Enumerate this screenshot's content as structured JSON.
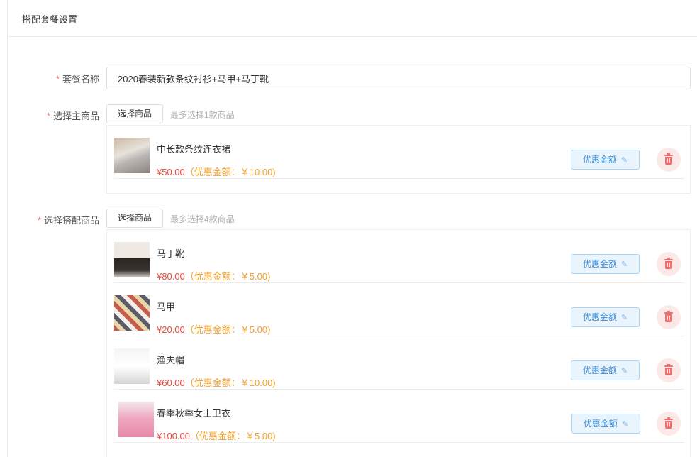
{
  "header": {
    "title": "搭配套餐设置"
  },
  "form": {
    "required_mark": "*",
    "name_label": "套餐名称",
    "name_value": "2020春装新款条纹衬衫+马甲+马丁靴",
    "main_label": "选择主商品",
    "main_select_button": "选择商品",
    "main_hint": "最多选择1款商品",
    "combo_label": "选择搭配商品",
    "combo_select_button": "选择商品",
    "combo_hint": "最多选择4款商品"
  },
  "discount_button_label": "优惠金额",
  "main_products": [
    {
      "name": "中长款条纹连衣裙",
      "price": "¥50.00",
      "discount": "（优惠金额：￥10.00)",
      "thumb_icon": "dress-photo"
    }
  ],
  "combo_products": [
    {
      "name": "马丁靴",
      "price": "¥80.00",
      "discount": "（优惠金额：￥5.00)",
      "thumb_icon": "boots-photo"
    },
    {
      "name": "马甲",
      "price": "¥20.00",
      "discount": "（优惠金额：￥5.00)",
      "thumb_icon": "vest-photo"
    },
    {
      "name": "渔夫帽",
      "price": "¥60.00",
      "discount": "（优惠金额：￥10.00)",
      "thumb_icon": "hat-photo"
    },
    {
      "name": "春季秋季女士卫衣",
      "price": "¥100.00",
      "discount": "（优惠金额：￥5.00)",
      "thumb_icon": "hoodie-photo"
    }
  ],
  "colors": {
    "price": "#e84c3d",
    "discount": "#f0a12b",
    "required": "#f56c6c",
    "accent": "#3d8dd6"
  }
}
